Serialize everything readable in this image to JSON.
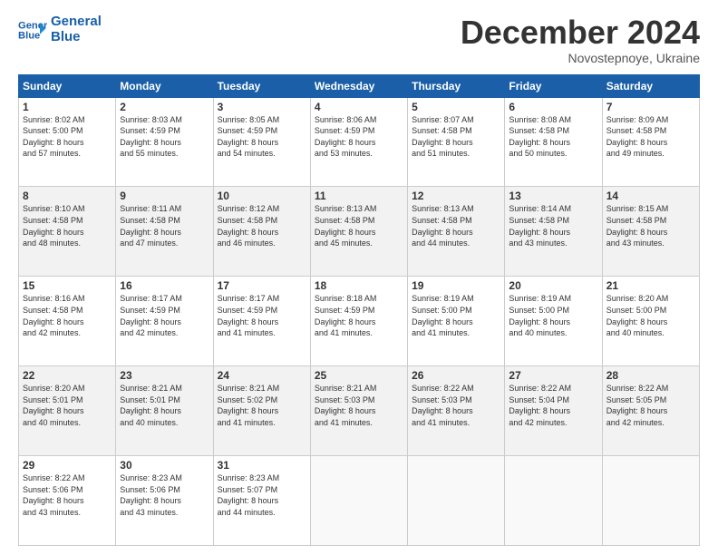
{
  "header": {
    "logo_line1": "General",
    "logo_line2": "Blue",
    "month": "December 2024",
    "location": "Novostepnoye, Ukraine"
  },
  "weekdays": [
    "Sunday",
    "Monday",
    "Tuesday",
    "Wednesday",
    "Thursday",
    "Friday",
    "Saturday"
  ],
  "weeks": [
    [
      {
        "day": "1",
        "lines": [
          "Sunrise: 8:02 AM",
          "Sunset: 5:00 PM",
          "Daylight: 8 hours",
          "and 57 minutes."
        ]
      },
      {
        "day": "2",
        "lines": [
          "Sunrise: 8:03 AM",
          "Sunset: 4:59 PM",
          "Daylight: 8 hours",
          "and 55 minutes."
        ]
      },
      {
        "day": "3",
        "lines": [
          "Sunrise: 8:05 AM",
          "Sunset: 4:59 PM",
          "Daylight: 8 hours",
          "and 54 minutes."
        ]
      },
      {
        "day": "4",
        "lines": [
          "Sunrise: 8:06 AM",
          "Sunset: 4:59 PM",
          "Daylight: 8 hours",
          "and 53 minutes."
        ]
      },
      {
        "day": "5",
        "lines": [
          "Sunrise: 8:07 AM",
          "Sunset: 4:58 PM",
          "Daylight: 8 hours",
          "and 51 minutes."
        ]
      },
      {
        "day": "6",
        "lines": [
          "Sunrise: 8:08 AM",
          "Sunset: 4:58 PM",
          "Daylight: 8 hours",
          "and 50 minutes."
        ]
      },
      {
        "day": "7",
        "lines": [
          "Sunrise: 8:09 AM",
          "Sunset: 4:58 PM",
          "Daylight: 8 hours",
          "and 49 minutes."
        ]
      }
    ],
    [
      {
        "day": "8",
        "lines": [
          "Sunrise: 8:10 AM",
          "Sunset: 4:58 PM",
          "Daylight: 8 hours",
          "and 48 minutes."
        ]
      },
      {
        "day": "9",
        "lines": [
          "Sunrise: 8:11 AM",
          "Sunset: 4:58 PM",
          "Daylight: 8 hours",
          "and 47 minutes."
        ]
      },
      {
        "day": "10",
        "lines": [
          "Sunrise: 8:12 AM",
          "Sunset: 4:58 PM",
          "Daylight: 8 hours",
          "and 46 minutes."
        ]
      },
      {
        "day": "11",
        "lines": [
          "Sunrise: 8:13 AM",
          "Sunset: 4:58 PM",
          "Daylight: 8 hours",
          "and 45 minutes."
        ]
      },
      {
        "day": "12",
        "lines": [
          "Sunrise: 8:13 AM",
          "Sunset: 4:58 PM",
          "Daylight: 8 hours",
          "and 44 minutes."
        ]
      },
      {
        "day": "13",
        "lines": [
          "Sunrise: 8:14 AM",
          "Sunset: 4:58 PM",
          "Daylight: 8 hours",
          "and 43 minutes."
        ]
      },
      {
        "day": "14",
        "lines": [
          "Sunrise: 8:15 AM",
          "Sunset: 4:58 PM",
          "Daylight: 8 hours",
          "and 43 minutes."
        ]
      }
    ],
    [
      {
        "day": "15",
        "lines": [
          "Sunrise: 8:16 AM",
          "Sunset: 4:58 PM",
          "Daylight: 8 hours",
          "and 42 minutes."
        ]
      },
      {
        "day": "16",
        "lines": [
          "Sunrise: 8:17 AM",
          "Sunset: 4:59 PM",
          "Daylight: 8 hours",
          "and 42 minutes."
        ]
      },
      {
        "day": "17",
        "lines": [
          "Sunrise: 8:17 AM",
          "Sunset: 4:59 PM",
          "Daylight: 8 hours",
          "and 41 minutes."
        ]
      },
      {
        "day": "18",
        "lines": [
          "Sunrise: 8:18 AM",
          "Sunset: 4:59 PM",
          "Daylight: 8 hours",
          "and 41 minutes."
        ]
      },
      {
        "day": "19",
        "lines": [
          "Sunrise: 8:19 AM",
          "Sunset: 5:00 PM",
          "Daylight: 8 hours",
          "and 41 minutes."
        ]
      },
      {
        "day": "20",
        "lines": [
          "Sunrise: 8:19 AM",
          "Sunset: 5:00 PM",
          "Daylight: 8 hours",
          "and 40 minutes."
        ]
      },
      {
        "day": "21",
        "lines": [
          "Sunrise: 8:20 AM",
          "Sunset: 5:00 PM",
          "Daylight: 8 hours",
          "and 40 minutes."
        ]
      }
    ],
    [
      {
        "day": "22",
        "lines": [
          "Sunrise: 8:20 AM",
          "Sunset: 5:01 PM",
          "Daylight: 8 hours",
          "and 40 minutes."
        ]
      },
      {
        "day": "23",
        "lines": [
          "Sunrise: 8:21 AM",
          "Sunset: 5:01 PM",
          "Daylight: 8 hours",
          "and 40 minutes."
        ]
      },
      {
        "day": "24",
        "lines": [
          "Sunrise: 8:21 AM",
          "Sunset: 5:02 PM",
          "Daylight: 8 hours",
          "and 41 minutes."
        ]
      },
      {
        "day": "25",
        "lines": [
          "Sunrise: 8:21 AM",
          "Sunset: 5:03 PM",
          "Daylight: 8 hours",
          "and 41 minutes."
        ]
      },
      {
        "day": "26",
        "lines": [
          "Sunrise: 8:22 AM",
          "Sunset: 5:03 PM",
          "Daylight: 8 hours",
          "and 41 minutes."
        ]
      },
      {
        "day": "27",
        "lines": [
          "Sunrise: 8:22 AM",
          "Sunset: 5:04 PM",
          "Daylight: 8 hours",
          "and 42 minutes."
        ]
      },
      {
        "day": "28",
        "lines": [
          "Sunrise: 8:22 AM",
          "Sunset: 5:05 PM",
          "Daylight: 8 hours",
          "and 42 minutes."
        ]
      }
    ],
    [
      {
        "day": "29",
        "lines": [
          "Sunrise: 8:22 AM",
          "Sunset: 5:06 PM",
          "Daylight: 8 hours",
          "and 43 minutes."
        ]
      },
      {
        "day": "30",
        "lines": [
          "Sunrise: 8:23 AM",
          "Sunset: 5:06 PM",
          "Daylight: 8 hours",
          "and 43 minutes."
        ]
      },
      {
        "day": "31",
        "lines": [
          "Sunrise: 8:23 AM",
          "Sunset: 5:07 PM",
          "Daylight: 8 hours",
          "and 44 minutes."
        ]
      },
      null,
      null,
      null,
      null
    ]
  ]
}
